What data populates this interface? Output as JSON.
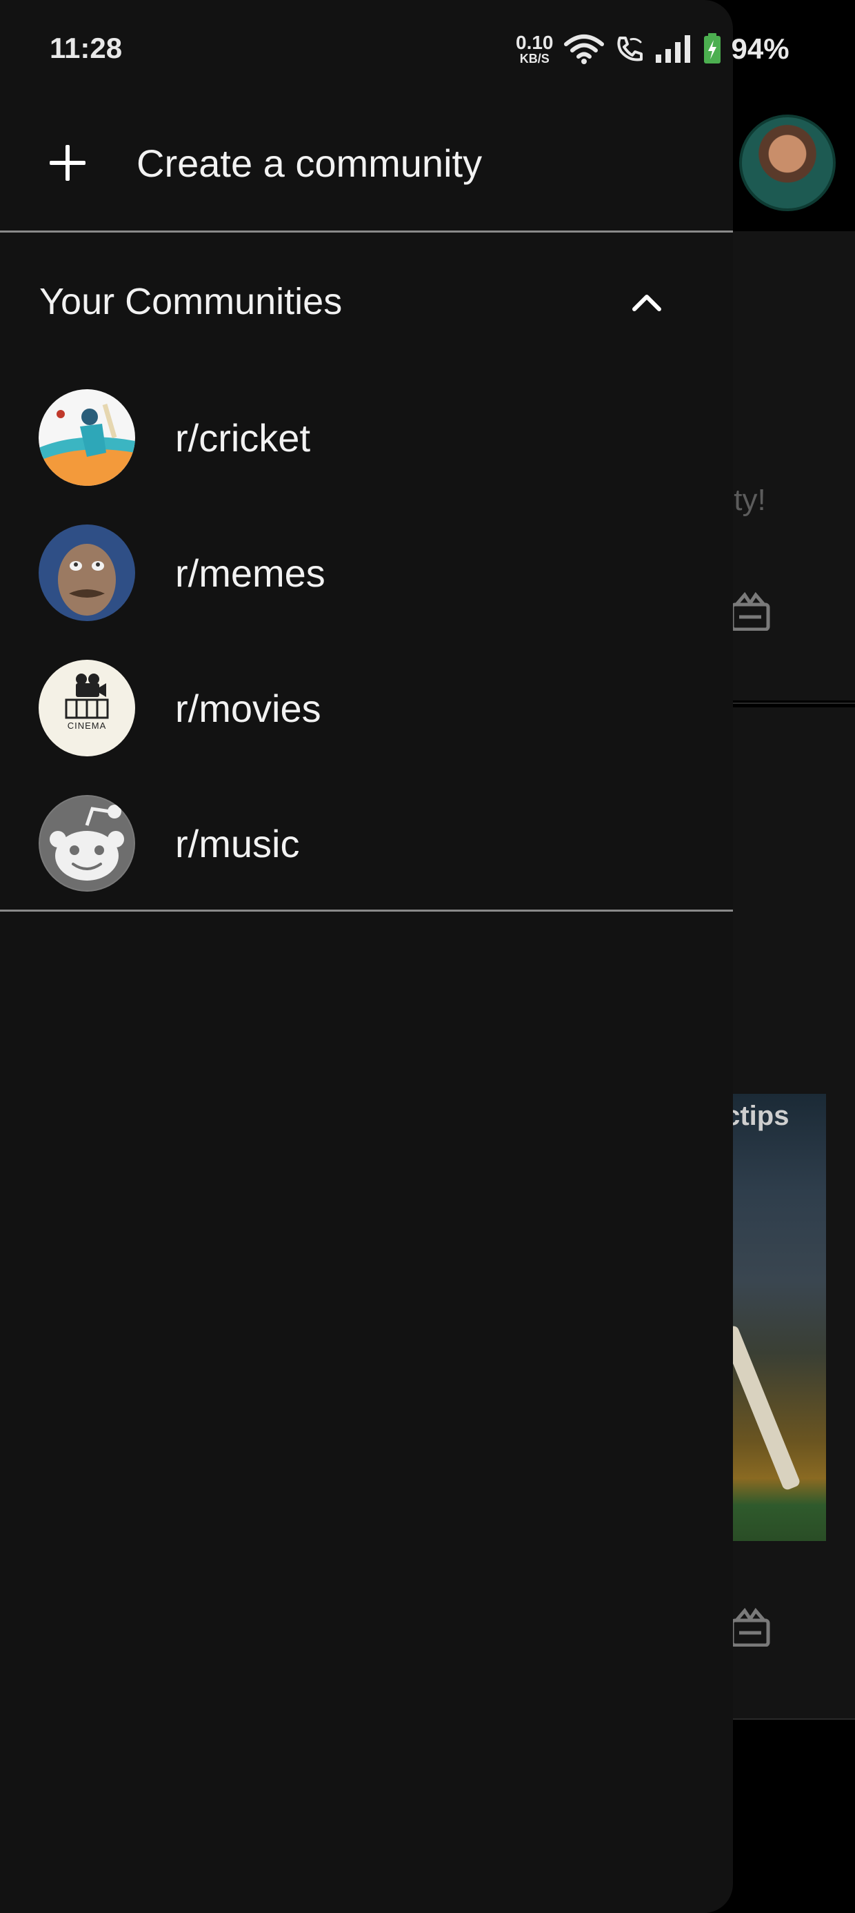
{
  "status_bar": {
    "time": "11:28",
    "net_speed_value": "0.10",
    "net_speed_unit": "KB/S",
    "battery": "94%"
  },
  "drawer": {
    "create_label": "Create a community",
    "section_title": "Your Communities",
    "communities": [
      {
        "label": "r/cricket",
        "icon": "cricket-avatar"
      },
      {
        "label": "r/memes",
        "icon": "memes-avatar"
      },
      {
        "label": "r/movies",
        "icon": "movies-avatar",
        "avatar_text": "CINEMA"
      },
      {
        "label": "r/music",
        "icon": "reddit-snoo-avatar"
      }
    ]
  },
  "background": {
    "visible_text": "nity!",
    "photo_brand": "ictips"
  },
  "colors": {
    "drawer_bg": "#121212",
    "divider": "#8a8a8a",
    "text": "#f2f2f2",
    "battery_green": "#4caf50"
  }
}
